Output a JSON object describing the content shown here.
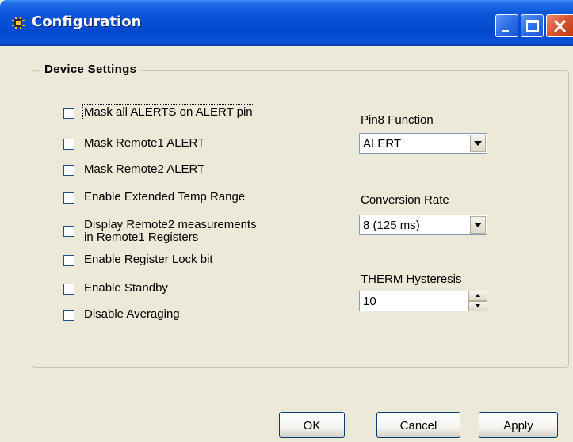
{
  "window": {
    "title": "Configuration",
    "icon": "chip-icon",
    "controls": [
      "minimize-icon",
      "maximize-icon",
      "close-icon"
    ]
  },
  "group": {
    "label": "Device  Settings"
  },
  "checkboxes": [
    {
      "label": "Mask all  ALERTS on ALERT pin",
      "checked": false,
      "focused": true
    },
    {
      "label": "Mask Remote1 ALERT",
      "checked": false
    },
    {
      "label": "Mask Remote2 ALERT",
      "checked": false
    },
    {
      "label": "Enable  Extended Temp  Range",
      "checked": false
    },
    {
      "label_line1": "Display Remote2 measurements",
      "label_line2": "in Remote1 Registers",
      "checked": false
    },
    {
      "label": "Enable Register Lock bit",
      "checked": false
    },
    {
      "label": "Enable Standby",
      "checked": false
    },
    {
      "label": "Disable Averaging",
      "checked": false
    }
  ],
  "pin8": {
    "label": "Pin8 Function",
    "value": "ALERT"
  },
  "conversion": {
    "label": "Conversion Rate",
    "value": "8 (125 ms)"
  },
  "therm": {
    "label": "THERM Hysteresis",
    "value": "10"
  },
  "buttons": {
    "ok": "OK",
    "cancel": "Cancel",
    "apply": "Apply"
  },
  "colors": {
    "titlebar": "#0a55d8",
    "dialog_bg": "#ece9d8",
    "close_button": "#d9532f"
  }
}
